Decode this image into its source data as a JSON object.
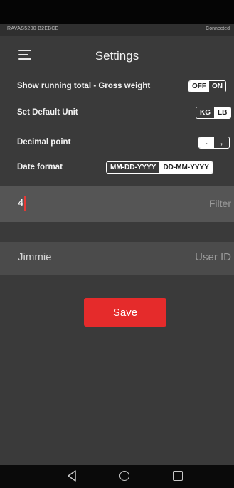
{
  "device": {
    "name": "RAVAS5200 B2EBCE",
    "status": "Connected"
  },
  "header": {
    "title": "Settings",
    "menu_icon": "hamburger-menu-icon"
  },
  "settings": {
    "running_total": {
      "label": "Show running total - Gross weight",
      "options": [
        "OFF",
        "ON"
      ],
      "selected": "OFF"
    },
    "default_unit": {
      "label": "Set Default Unit",
      "options": [
        "KG",
        "LB"
      ],
      "selected": "KG"
    },
    "decimal_point": {
      "label": "Decimal point",
      "options": [
        ".",
        ","
      ],
      "selected": "."
    },
    "date_format": {
      "label": "Date format",
      "options": [
        "MM-DD-YYYY",
        "DD-MM-YYYY"
      ],
      "selected": "MM-DD-YYYY"
    }
  },
  "filter": {
    "value": "4",
    "placeholder": "Filter"
  },
  "user": {
    "value": "Jimmie",
    "placeholder": "User ID"
  },
  "save_label": "Save",
  "colors": {
    "accent": "#e52b2b",
    "background": "#3a3a3a"
  },
  "nav_icons": [
    "back-icon",
    "home-icon",
    "recent-apps-icon"
  ]
}
